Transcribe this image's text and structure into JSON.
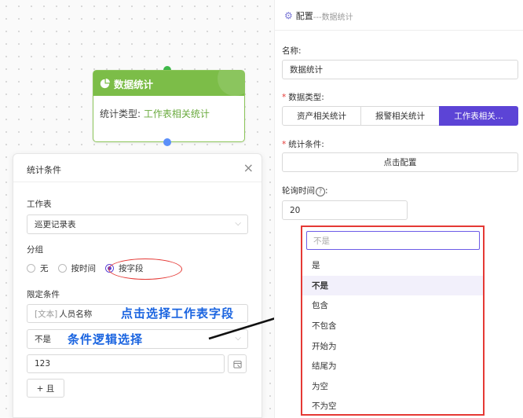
{
  "node": {
    "title": "数据统计",
    "type_label": "统计类型:",
    "type_value": "工作表相关统计"
  },
  "panel": {
    "title": "统计条件",
    "close": "×",
    "sheet_label": "工作表",
    "sheet_value": "巡更记录表",
    "group_label": "分组",
    "group_options": [
      "无",
      "按时间",
      "按字段"
    ],
    "group_selected": "按字段",
    "limit_label": "限定条件",
    "field_prefix": "[文本]",
    "field_value": "人员名称",
    "logic_value": "不是",
    "input_value": "123",
    "add_button": "+ 且"
  },
  "annotations": {
    "first": "点击选择工作表字段",
    "second": "条件逻辑选择"
  },
  "config": {
    "title": "配置",
    "subtitle": "---数据统计",
    "name_label": "名称:",
    "name_value": "数据统计",
    "data_type_label": "数据类型:",
    "data_type_options": [
      "资产相关统计",
      "报警相关统计",
      "工作表相关..."
    ],
    "data_type_selected": "工作表相关...",
    "condition_label": "统计条件:",
    "configure_button": "点击配置",
    "poll_label": "轮询时间",
    "poll_value": "20"
  },
  "dropdown": {
    "search_placeholder": "不是",
    "options": [
      "是",
      "不是",
      "包含",
      "不包含",
      "开始为",
      "结尾为",
      "为空",
      "不为空"
    ],
    "selected": "不是"
  },
  "colors": {
    "node_green": "#7cbd48",
    "accent_purple": "#5c44d6",
    "highlight_red": "#e53935",
    "annotation_blue": "#1a64e0"
  }
}
